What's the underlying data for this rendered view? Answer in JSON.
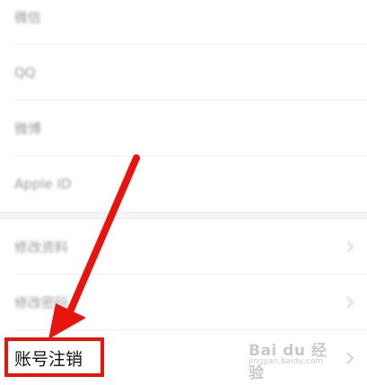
{
  "settings": {
    "rows": [
      {
        "label": "微信"
      },
      {
        "label": "QQ"
      },
      {
        "label": "微博"
      },
      {
        "label": "Apple ID"
      },
      {
        "label": "修改资料"
      },
      {
        "label": "修改密码"
      },
      {
        "label": "账号注销"
      }
    ]
  },
  "watermark": {
    "brand": "Bai du 经验",
    "url": "jingyan.baidu.com"
  },
  "annotation": {
    "color": "#e8150e"
  },
  "icons": {
    "chevron": "chevron-right-icon"
  }
}
